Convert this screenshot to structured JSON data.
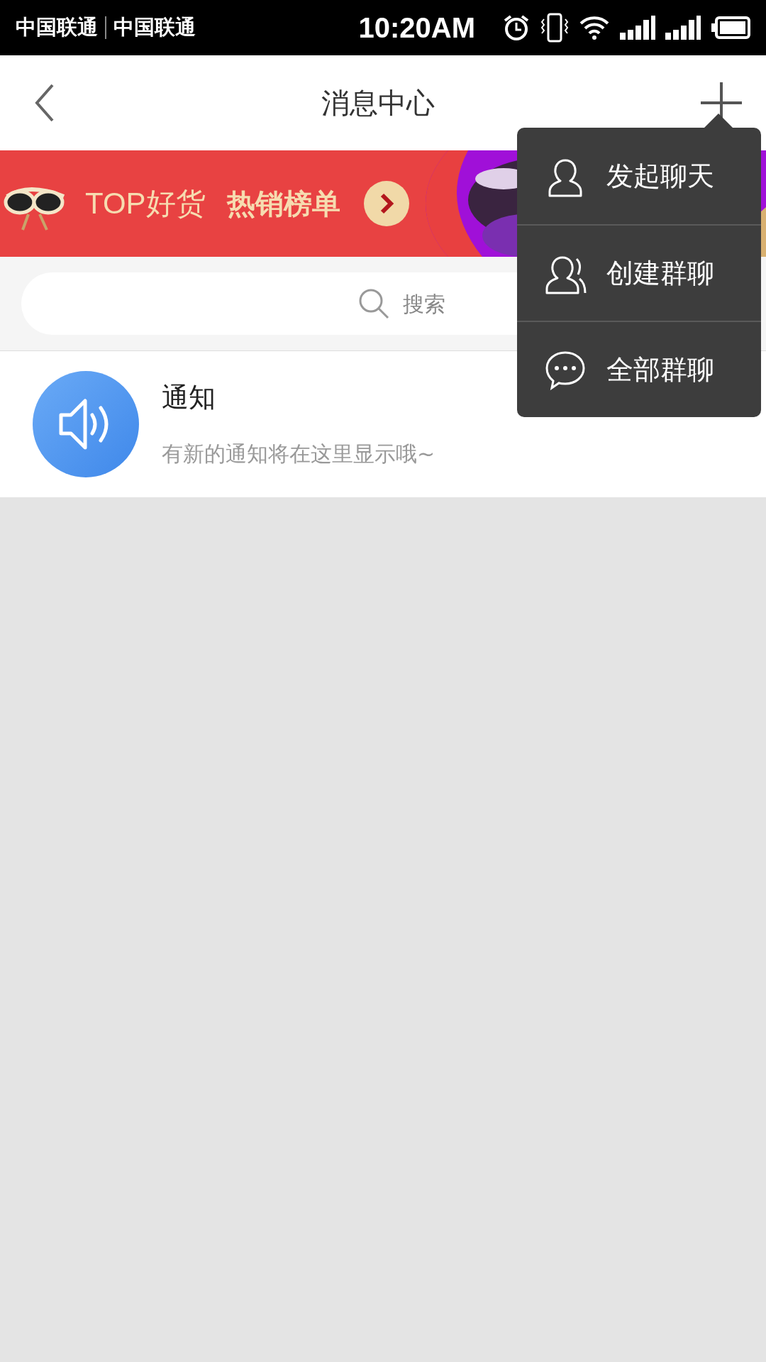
{
  "status_bar": {
    "carriers": [
      "中国联通",
      "中国联通"
    ],
    "time": "10:20AM"
  },
  "nav_bar": {
    "title": "消息中心"
  },
  "banner": {
    "kind": "picture",
    "text": "TOP好货",
    "highlight": "热销榜单"
  },
  "search": {
    "placeholder": "搜索"
  },
  "messages": [
    {
      "title": "通知",
      "preview": "有新的通知将在这里显示哦~"
    }
  ],
  "menu": {
    "items": [
      {
        "kind": "person",
        "label": "发起聊天"
      },
      {
        "kind": "group",
        "label": "创建群聊"
      },
      {
        "kind": "chat",
        "label": "全部群聊"
      }
    ]
  }
}
